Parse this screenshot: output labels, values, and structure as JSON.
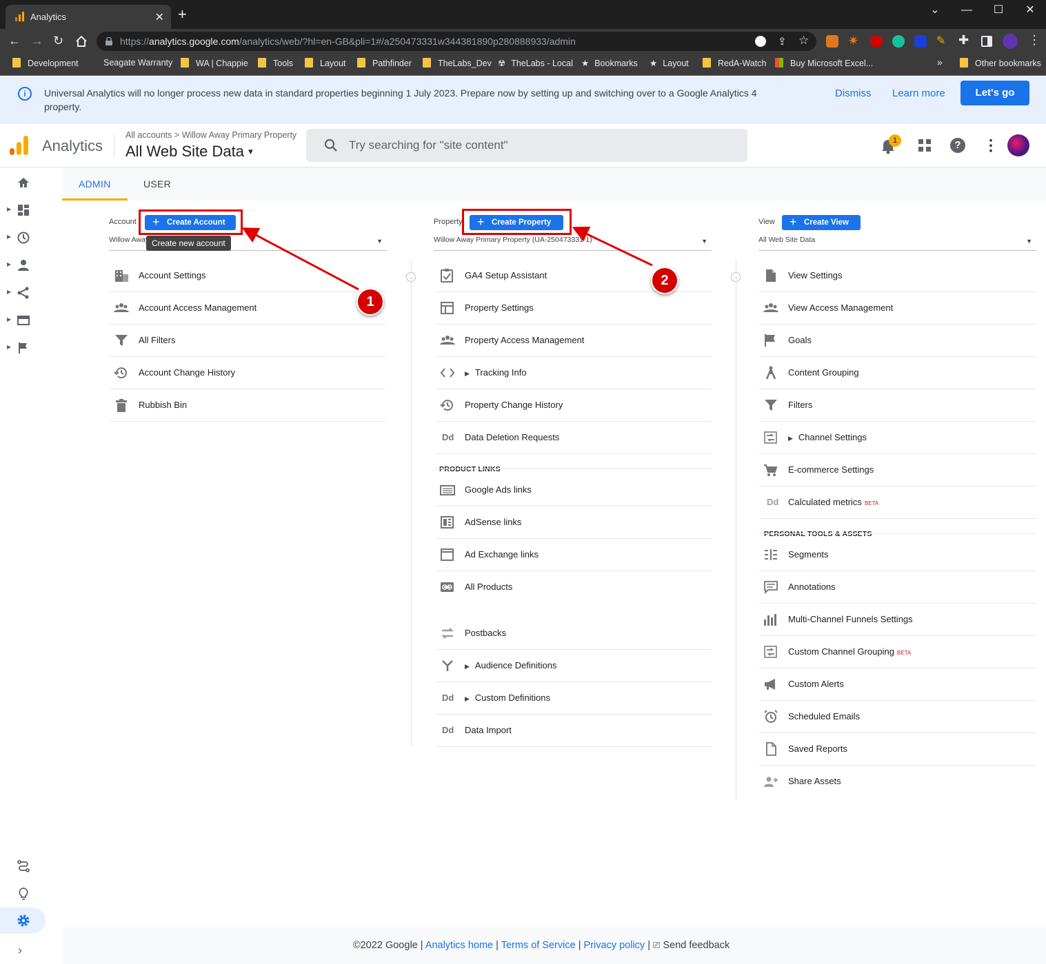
{
  "browser": {
    "tab_title": "Analytics",
    "tab_close": "✕",
    "new_tab": "+",
    "url_prefix": "https://",
    "url_host": "analytics.google.com",
    "url_path": "/analytics/web/?hl=en-GB&pli=1#/a250473331w344381890p280888933/admin",
    "bookmarks": [
      "Development",
      "Seagate Warranty",
      "WA | Chappie",
      "Tools",
      "Layout",
      "Pathfinder",
      "TheLabs_Dev",
      "TheLabs - Local",
      "Bookmarks",
      "Layout",
      "RedA-Watch",
      "Buy Microsoft Excel...",
      "Other bookmarks"
    ],
    "bookmarks_overflow": "»"
  },
  "banner": {
    "text": "Universal Analytics will no longer process new data in standard properties beginning 1 July 2023. Prepare now by setting up and switching over to a Google Analytics 4 property.",
    "dismiss": "Dismiss",
    "learn_more": "Learn more",
    "lets_go": "Let's go"
  },
  "header": {
    "brand": "Analytics",
    "crumb_root": "All accounts",
    "crumb_sep": ">",
    "crumb_property": "Willow Away Primary Property",
    "view_name": "All Web Site Data",
    "search_placeholder": "Try searching for \"site content\"",
    "notification_count": "1"
  },
  "tabs": {
    "admin": "ADMIN",
    "user": "USER"
  },
  "account": {
    "label": "Account",
    "create_button": "Create Account",
    "selected": "Willow Away",
    "tooltip": "Create new account",
    "items": [
      "Account Settings",
      "Account Access Management",
      "All Filters",
      "Account Change History",
      "Rubbish Bin"
    ]
  },
  "property": {
    "label": "Property",
    "create_button": "Create Property",
    "selected": "Willow Away Primary Property (UA-250473331-1)",
    "items": [
      "GA4 Setup Assistant",
      "Property Settings",
      "Property Access Management",
      "Tracking Info",
      "Property Change History",
      "Data Deletion Requests"
    ],
    "product_links_header": "PRODUCT LINKS",
    "product_links": [
      "Google Ads links",
      "AdSense links",
      "Ad Exchange links",
      "All Products"
    ],
    "more_items": [
      "Postbacks",
      "Audience Definitions",
      "Custom Definitions",
      "Data Import"
    ]
  },
  "view": {
    "label": "View",
    "create_button": "Create View",
    "selected": "All Web Site Data",
    "items": [
      "View Settings",
      "View Access Management",
      "Goals",
      "Content Grouping",
      "Filters",
      "Channel Settings",
      "E-commerce Settings",
      "Calculated metrics"
    ],
    "beta_tag": "BETA",
    "personal_header": "PERSONAL TOOLS & ASSETS",
    "personal_items": [
      "Segments",
      "Annotations",
      "Multi-Channel Funnels Settings",
      "Custom Channel Grouping",
      "Custom Alerts",
      "Scheduled Emails",
      "Saved Reports",
      "Share Assets"
    ]
  },
  "annotations": {
    "badge1": "1",
    "badge2": "2"
  },
  "icons": {
    "dd": "Dd"
  },
  "footer": {
    "copyright": "©2022 Google",
    "sep": "|",
    "analytics_home": "Analytics home",
    "terms": "Terms of Service",
    "privacy": "Privacy policy",
    "feedback": "Send feedback"
  },
  "colors": {
    "accent": "#1a73e8",
    "highlight": "#e00000",
    "banner_bg": "#e8f0fe"
  }
}
